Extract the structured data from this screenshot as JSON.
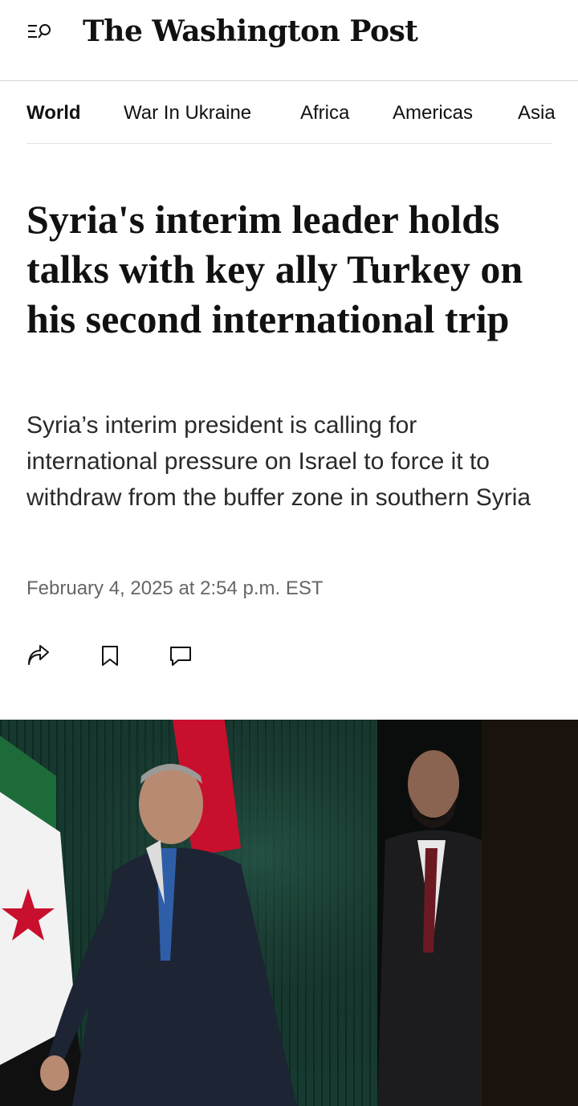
{
  "header": {
    "logo_text": "The Washington Post",
    "menu_icon": "menu-search-icon"
  },
  "nav": {
    "items": [
      {
        "label": "World",
        "active": true
      },
      {
        "label": "War In Ukraine",
        "active": false
      },
      {
        "label": "Africa",
        "active": false
      },
      {
        "label": "Americas",
        "active": false
      },
      {
        "label": "Asia",
        "active": false
      }
    ]
  },
  "article": {
    "headline": "Syria's interim leader holds talks with key ally Turkey on his second international trip",
    "dek": "Syria’s interim president is calling for international pressure on Israel to force it to withdraw from the buffer zone in southern Syria",
    "timestamp": "February 4, 2025 at 2:54 p.m. EST"
  },
  "actions": {
    "share_icon": "share-icon",
    "bookmark_icon": "bookmark-icon",
    "comment_icon": "comment-icon"
  },
  "colors": {
    "text": "#111111",
    "muted": "#666666",
    "divider": "#d6d6d6",
    "flag_red": "#c8102e",
    "flag_green": "#1e6b3a"
  }
}
